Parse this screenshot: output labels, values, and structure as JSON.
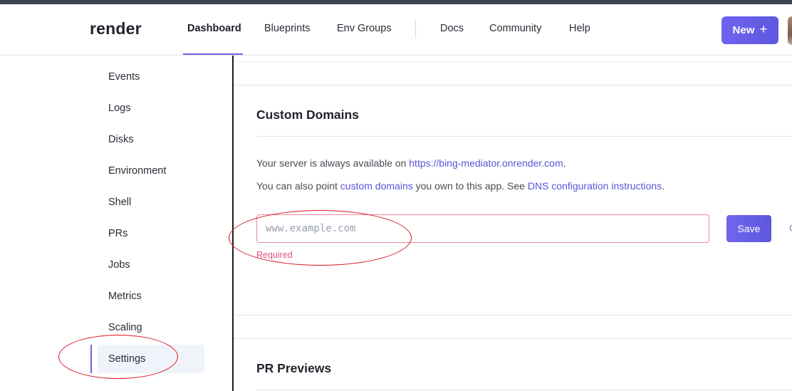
{
  "header": {
    "logo": "render",
    "nav": [
      "Dashboard",
      "Blueprints",
      "Env Groups",
      "Docs",
      "Community",
      "Help"
    ],
    "active_nav": "Dashboard",
    "new_button": "New",
    "new_icon": "plus-icon"
  },
  "sidebar": {
    "items": [
      "Events",
      "Logs",
      "Disks",
      "Environment",
      "Shell",
      "PRs",
      "Jobs",
      "Metrics",
      "Scaling",
      "Settings"
    ],
    "active": "Settings"
  },
  "custom_domains": {
    "title": "Custom Domains",
    "line1_prefix": "Your server is always available on ",
    "line1_link": "https://bing-mediator.onrender.com",
    "line1_suffix": ".",
    "line2_prefix": "You can also point ",
    "line2_link1": "custom domains",
    "line2_middle": " you own to this app. See ",
    "line2_link2": "DNS configuration instructions",
    "line2_suffix": ".",
    "input_placeholder": "www.example.com",
    "input_value": "",
    "validation": "Required",
    "save_button": "Save"
  },
  "pr_previews": {
    "title": "PR Previews"
  },
  "colors": {
    "accent": "#6b63e0",
    "error": "#e0537a",
    "annotation": "#d8141e"
  }
}
